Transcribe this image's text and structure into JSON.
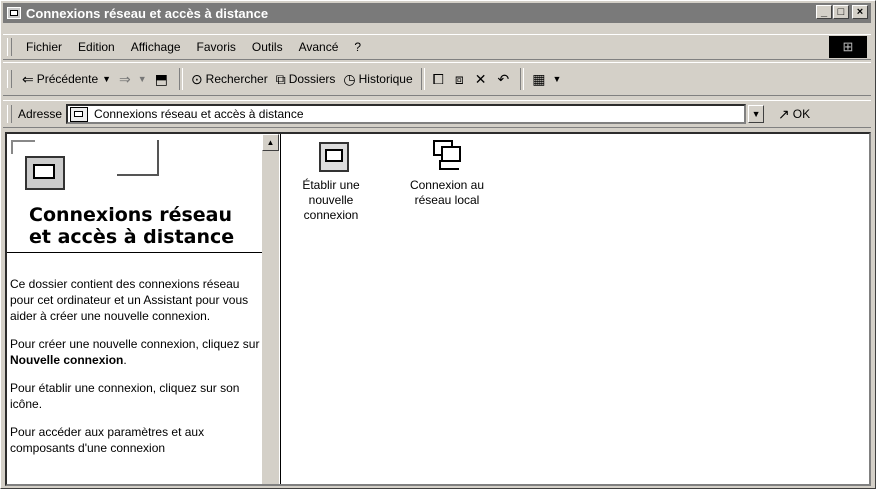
{
  "window": {
    "title": "Connexions réseau et accès à distance",
    "controls": {
      "minimize": "_",
      "maximize": "□",
      "close": "×"
    }
  },
  "menu": {
    "items": [
      "Fichier",
      "Edition",
      "Affichage",
      "Favoris",
      "Outils",
      "Avancé",
      "?"
    ]
  },
  "toolbar": {
    "back_label": "Précédente",
    "search_label": "Rechercher",
    "folders_label": "Dossiers",
    "history_label": "Historique"
  },
  "address": {
    "label": "Adresse",
    "value": "Connexions réseau et accès à distance",
    "go_label": "OK"
  },
  "left_pane": {
    "title_line1": "Connexions réseau",
    "title_line2": "et accès à distance",
    "para1": "Ce dossier contient des connexions réseau pour cet ordinateur et un Assistant pour vous aider à créer une nouvelle connexion.",
    "para2_prefix": "Pour créer une nouvelle connexion, cliquez sur ",
    "para2_bold": "Nouvelle connexion",
    "para2_suffix": ".",
    "para3": "Pour établir une connexion, cliquez sur son icône.",
    "para4": "Pour accéder aux paramètres et aux composants d'une connexion"
  },
  "items": [
    {
      "label_lines": [
        "Établir une",
        "nouvelle",
        "connexion"
      ],
      "icon": "new-connection-icon"
    },
    {
      "label_lines": [
        "Connexion au",
        "réseau local"
      ],
      "icon": "lan-connection-icon"
    }
  ]
}
